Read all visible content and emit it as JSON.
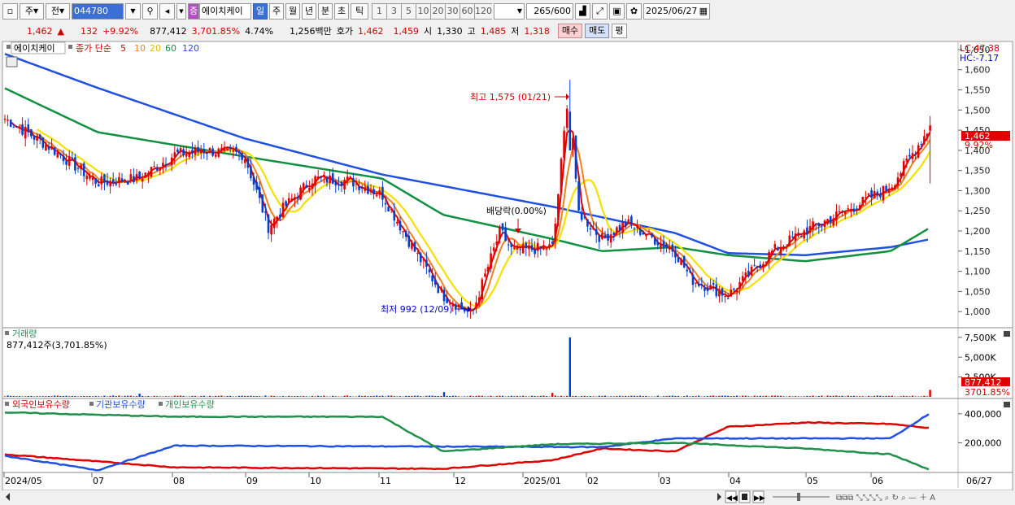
{
  "toolbar": {
    "period_options": [
      "주",
      "전"
    ],
    "code_value": "044780",
    "stock_badge": "증",
    "stock_name": "에이치케이",
    "period_tabs": [
      "일",
      "주",
      "월",
      "년",
      "분",
      "초",
      "틱"
    ],
    "interval_buttons": [
      "1",
      "3",
      "5",
      "10",
      "20",
      "30",
      "60",
      "120"
    ],
    "bar_count": "265",
    "bar_total": "/600",
    "date": "2025/06/27"
  },
  "info": {
    "price": "1,462",
    "change_arrow": "▲",
    "change": "132",
    "change_pct": "+9.92%",
    "volume": "877,412",
    "volume_ratio": "3,701.85%",
    "turnover": "4.74%",
    "amount": "1,256백만",
    "ask_label": "호가",
    "ask": "1,462",
    "bid": "1,459",
    "open_label": "시",
    "open": "1,330",
    "high_label": "고",
    "high": "1,485",
    "low_label": "저",
    "low": "1,318",
    "buy_label": "매수",
    "sell_label": "매도",
    "eval_label": "평"
  },
  "price_panel": {
    "name": "에이치케이",
    "legend_prefix": "종가 단순",
    "ma_labels": [
      "5",
      "10",
      "20",
      "60",
      "120"
    ],
    "lc_label": "LC:47.38",
    "hc_label": "HC:-7.17",
    "high_annotation": "최고 1,575 (01/21)",
    "low_annotation": "최저 992 (12/09)",
    "exright_annotation": "배당락(0.00%)",
    "last_price_tag": "1,462",
    "last_pct_tag": "9.92%",
    "yticks": [
      "1,650",
      "1,600",
      "1,550",
      "1,500",
      "1,450",
      "1,400",
      "1,350",
      "1,300",
      "1,250",
      "1,200",
      "1,150",
      "1,100",
      "1,050",
      "1,000"
    ]
  },
  "volume_panel": {
    "title": "거래량",
    "value": "877,412주(3,701.85%)",
    "yticks": [
      "7,500K",
      "5,000K",
      "2,500K"
    ],
    "last_tag": "877,412",
    "last_pct_tag": "3701.85%"
  },
  "holding_panel": {
    "legend": [
      "외국인보유수량",
      "기관보유수량",
      "개인보유수량"
    ],
    "yticks": [
      "400,000",
      "200,000"
    ]
  },
  "xaxis": {
    "labels": [
      "2024/05",
      "07",
      "08",
      "09",
      "10",
      "11",
      "12",
      "2025/01",
      "02",
      "03",
      "04",
      "05",
      "06",
      "06/27"
    ]
  },
  "colors": {
    "ma5": "#e00000",
    "ma10": "#f08020",
    "ma20": "#f5e000",
    "ma60": "#109040",
    "ma120": "#2050e0",
    "up": "#e00000",
    "down": "#0040d0",
    "foreign": "#e00000",
    "institution": "#2050e0",
    "individual": "#20904a"
  },
  "chart_data": [
    {
      "type": "candlestick",
      "title": "에이치케이",
      "ylim": [
        960,
        1660
      ],
      "price_keypoints": [
        [
          "2024/05",
          1480
        ],
        [
          "2024/06",
          1410
        ],
        [
          "2024/07",
          1320
        ],
        [
          "2024/07b",
          1330
        ],
        [
          "2024/08",
          1390
        ],
        [
          "2024/08b",
          1400
        ],
        [
          "2024/09",
          1390
        ],
        [
          "2024/09b",
          1210
        ],
        [
          "2024/09c",
          1260
        ],
        [
          "2024/10",
          1330
        ],
        [
          "2024/10b",
          1325
        ],
        [
          "2024/11",
          1290
        ],
        [
          "2024/11b",
          1150
        ],
        [
          "2024/12",
          1040
        ],
        [
          "2024/12b",
          992
        ],
        [
          "2024/12c",
          1200
        ],
        [
          "2024/12d",
          1150
        ],
        [
          "2025/01",
          1160
        ],
        [
          "2025/01b",
          1575
        ],
        [
          "2025/01c",
          1250
        ],
        [
          "2025/02",
          1180
        ],
        [
          "2025/02b",
          1220
        ],
        [
          "2025/03",
          1150
        ],
        [
          "2025/03b",
          1080
        ],
        [
          "2025/04",
          1040
        ],
        [
          "2025/04b",
          1150
        ],
        [
          "2025/05",
          1200
        ],
        [
          "2025/05b",
          1260
        ],
        [
          "2025/06",
          1310
        ],
        [
          "2025/06/27",
          1462
        ]
      ],
      "ma120_keypoints": [
        [
          "2024/05",
          1640
        ],
        [
          "2024/07",
          1555
        ],
        [
          "2024/09",
          1430
        ],
        [
          "2024/11",
          1340
        ],
        [
          "2025/01",
          1260
        ],
        [
          "2025/03",
          1195
        ],
        [
          "2025/04",
          1145
        ],
        [
          "2025/05",
          1140
        ],
        [
          "2025/06",
          1160
        ],
        [
          "2025/06/27",
          1180
        ]
      ],
      "ma60_keypoints": [
        [
          "2024/05",
          1555
        ],
        [
          "2024/07",
          1445
        ],
        [
          "2024/09",
          1385
        ],
        [
          "2024/11",
          1330
        ],
        [
          "2024/12",
          1240
        ],
        [
          "2025/01",
          1180
        ],
        [
          "2025/02",
          1150
        ],
        [
          "2025/03",
          1160
        ],
        [
          "2025/04",
          1140
        ],
        [
          "2025/05",
          1125
        ],
        [
          "2025/06",
          1150
        ],
        [
          "2025/06/27",
          1210
        ]
      ],
      "high": 1575,
      "low": 992,
      "last": 1462
    },
    {
      "type": "bar",
      "title": "거래량",
      "unit": "shares",
      "ylim": [
        0,
        8000000
      ],
      "keypoints": [
        [
          "2024/07b",
          400000
        ],
        [
          "2024/12",
          600000
        ],
        [
          "2025/01",
          500000
        ],
        [
          "2025/01b",
          7500000
        ],
        [
          "2025/06/27",
          877412
        ]
      ]
    },
    {
      "type": "line",
      "series": [
        {
          "name": "외국인보유수량",
          "keypoints": [
            [
              "2024/05",
              120000
            ],
            [
              "2024/08",
              30000
            ],
            [
              "2024/12",
              20000
            ],
            [
              "2025/01",
              80000
            ],
            [
              "2025/02",
              160000
            ],
            [
              "2025/03",
              140000
            ],
            [
              "2025/04",
              310000
            ],
            [
              "2025/05",
              340000
            ],
            [
              "2025/06",
              330000
            ],
            [
              "2025/06/27",
              300000
            ]
          ]
        },
        {
          "name": "기관보유수량",
          "keypoints": [
            [
              "2024/05",
              110000
            ],
            [
              "2024/07",
              10000
            ],
            [
              "2024/08",
              180000
            ],
            [
              "2025/02",
              170000
            ],
            [
              "2025/03",
              230000
            ],
            [
              "2025/06",
              230000
            ],
            [
              "2025/06/27",
              410000
            ]
          ]
        },
        {
          "name": "개인보유수량",
          "keypoints": [
            [
              "2024/05",
              410000
            ],
            [
              "2024/08",
              380000
            ],
            [
              "2024/11",
              380000
            ],
            [
              "2024/12",
              140000
            ],
            [
              "2025/01",
              190000
            ],
            [
              "2025/03",
              200000
            ],
            [
              "2025/05",
              160000
            ],
            [
              "2025/06",
              120000
            ],
            [
              "2025/06/27",
              10000
            ]
          ]
        }
      ],
      "ylim": [
        0,
        450000
      ]
    }
  ]
}
